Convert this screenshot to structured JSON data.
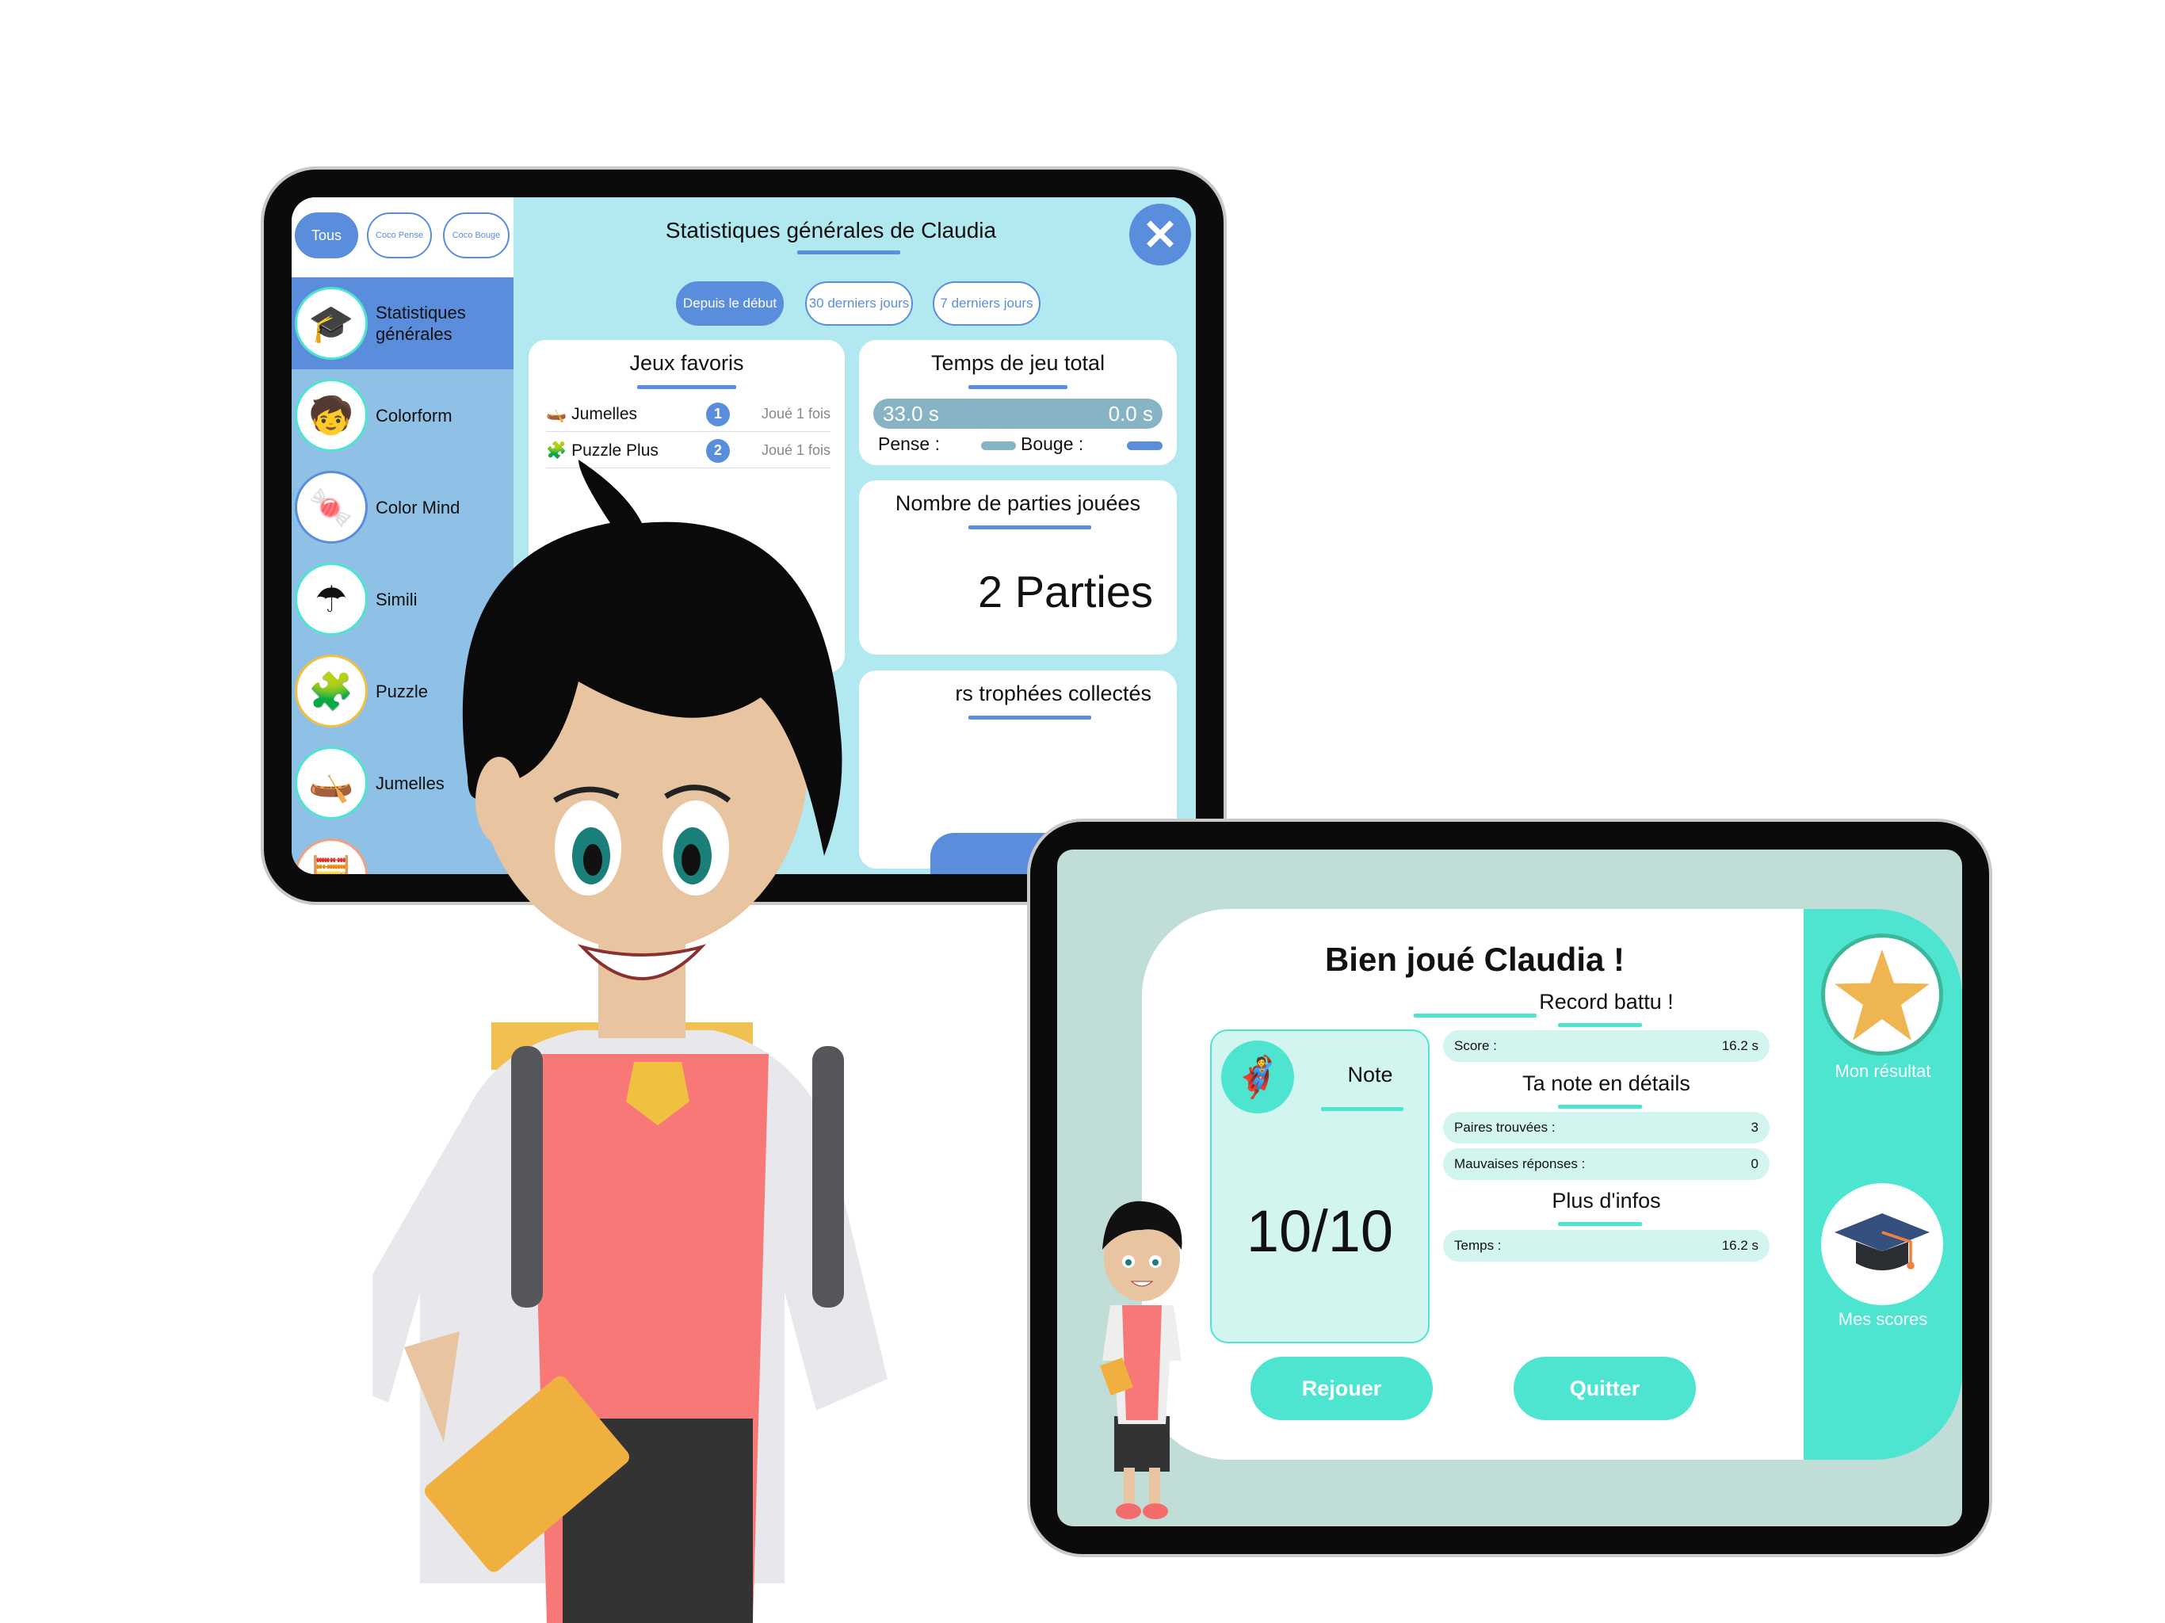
{
  "stats_app": {
    "filter_chips": [
      "Tous",
      "Coco Pense",
      "Coco Bouge"
    ],
    "title": "Statistiques générales de Claudia",
    "period_pills": [
      "Depuis le début",
      "30 derniers jours",
      "7 derniers jours"
    ],
    "sidebar": {
      "items": [
        {
          "label": "Statistiques générales",
          "icon": "graduation-cap-icon",
          "selected": true
        },
        {
          "label": "Colorform",
          "icon": "child-hula-hoop-icon"
        },
        {
          "label": "Color Mind",
          "icon": "gumball-machine-icon"
        },
        {
          "label": "Simili",
          "icon": "umbrella-magnifier-icon"
        },
        {
          "label": "Puzzle",
          "icon": "puzzle-icon"
        },
        {
          "label": "Jumelles",
          "icon": "kayak-icon"
        }
      ]
    },
    "favorites": {
      "title": "Jeux favoris",
      "rows": [
        {
          "name": "Jumelles",
          "rank": "1",
          "played": "Joué 1 fois"
        },
        {
          "name": "Puzzle Plus",
          "rank": "2",
          "played": "Joué 1 fois"
        }
      ]
    },
    "total_time": {
      "title": "Temps de jeu total",
      "pense_value": "33.0 s",
      "bouge_value": "0.0 s",
      "pense_label": "Pense :",
      "bouge_label": "Bouge :",
      "pense_color": "#86b4c4",
      "bouge_color": "#5a8edc"
    },
    "games_played": {
      "title": "Nombre de parties jouées",
      "value": "2 Parties"
    },
    "trophies": {
      "title": "rs trophées collectés"
    },
    "colors": {
      "accent": "#5a8edc",
      "background": "#b2e9f1",
      "sidebar": "#8fc0e6"
    }
  },
  "result_app": {
    "title": "Bien joué Claudia !",
    "note": {
      "label": "Note",
      "value": "10/10"
    },
    "record": {
      "title": "Record battu !",
      "rows": [
        {
          "label": "Score :",
          "value": "16.2 s"
        }
      ]
    },
    "details": {
      "title": "Ta note en détails",
      "rows": [
        {
          "label": "Paires trouvées :",
          "value": "3"
        },
        {
          "label": "Mauvaises réponses :",
          "value": "0"
        }
      ]
    },
    "more": {
      "title": "Plus d'infos",
      "rows": [
        {
          "label": "Temps :",
          "value": "16.2 s"
        }
      ]
    },
    "buttons": {
      "replay": "Rejouer",
      "quit": "Quitter"
    },
    "side_nav": [
      {
        "label": "Mon résultat",
        "icon": "star-icon"
      },
      {
        "label": "Mes scores",
        "icon": "graduation-cap-icon"
      }
    ],
    "colors": {
      "accent": "#4de5d0",
      "background": "#c0ddd8"
    }
  }
}
